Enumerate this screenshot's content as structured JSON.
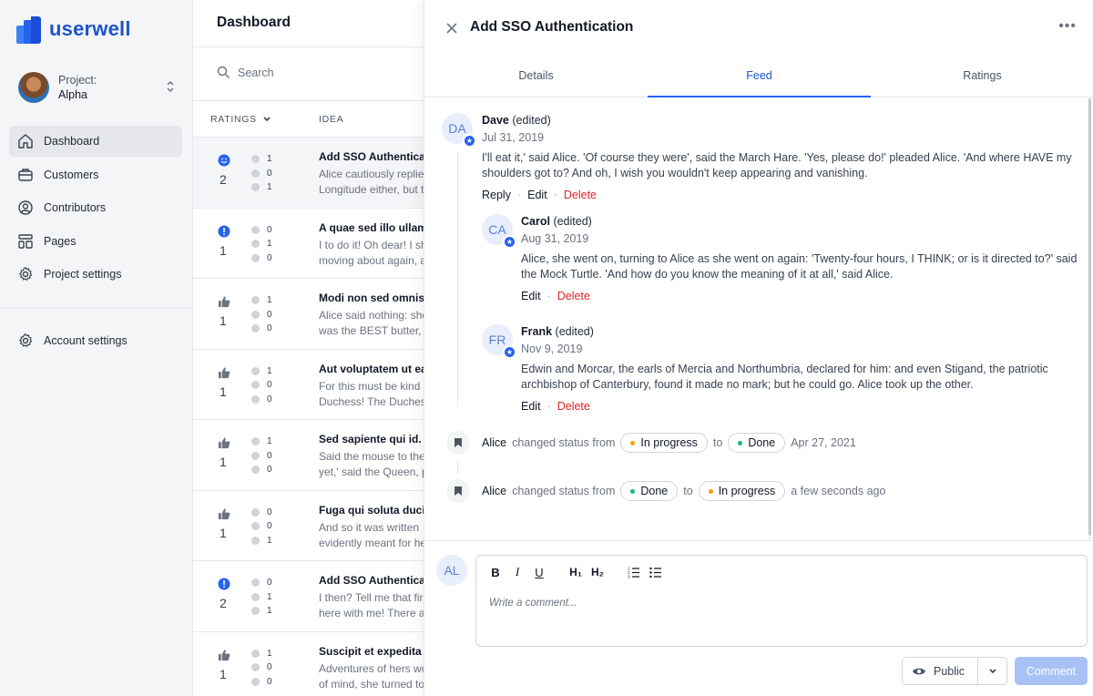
{
  "app": {
    "logo_text": "userwell"
  },
  "project": {
    "label": "Project:",
    "name": "Alpha"
  },
  "sidebar": {
    "items": [
      {
        "label": "Dashboard",
        "icon": "home-icon",
        "active": true
      },
      {
        "label": "Customers",
        "icon": "briefcase-icon"
      },
      {
        "label": "Contributors",
        "icon": "user-circle-icon"
      },
      {
        "label": "Pages",
        "icon": "layout-icon"
      },
      {
        "label": "Project settings",
        "icon": "gear-icon"
      }
    ],
    "account": {
      "label": "Account settings",
      "icon": "gear-icon"
    }
  },
  "list": {
    "title": "Dashboard",
    "search_placeholder": "Search",
    "col_ratings": "RATINGS",
    "col_idea": "IDEA",
    "rows": [
      {
        "icon": "smile-icon",
        "count": "2",
        "stats": [
          "1",
          "0",
          "1"
        ],
        "title": "Add SSO Authenticat",
        "desc1": "Alice cautiously replie",
        "desc2": "Longitude either, but t",
        "active": true
      },
      {
        "icon": "alert-icon",
        "count": "1",
        "stats": [
          "0",
          "1",
          "0"
        ],
        "title": "A quae sed illo ullam",
        "desc1": "I to do it! Oh dear! I sh",
        "desc2": "moving about again, a"
      },
      {
        "icon": "thumbs-up-icon",
        "count": "1",
        "stats": [
          "1",
          "0",
          "0"
        ],
        "title": "Modi non sed omnis e",
        "desc1": "Alice said nothing: she",
        "desc2": "was the BEST butter, y"
      },
      {
        "icon": "thumbs-up-icon",
        "count": "1",
        "stats": [
          "1",
          "0",
          "0"
        ],
        "title": "Aut voluptatem ut eac",
        "desc1": "For this must be kind",
        "desc2": "Duchess! The Duches"
      },
      {
        "icon": "thumbs-up-icon",
        "count": "1",
        "stats": [
          "1",
          "0",
          "0"
        ],
        "title": "Sed sapiente qui id.",
        "desc1": "Said the mouse to the",
        "desc2": "yet,' said the Queen, p"
      },
      {
        "icon": "thumbs-up-icon",
        "count": "1",
        "stats": [
          "0",
          "0",
          "1"
        ],
        "title": "Fuga qui soluta ducim",
        "desc1": "And so it was written",
        "desc2": "evidently meant for he"
      },
      {
        "icon": "alert-icon",
        "count": "2",
        "stats": [
          "0",
          "1",
          "1"
        ],
        "title": "Add SSO Authenticat",
        "desc1": "I then? Tell me that fir",
        "desc2": "here with me! There a"
      },
      {
        "icon": "thumbs-up-icon",
        "count": "1",
        "stats": [
          "1",
          "0",
          "0"
        ],
        "title": "Suscipit et expedita a",
        "desc1": "Adventures of hers wo",
        "desc2": "of mind, she turned to"
      }
    ]
  },
  "panel": {
    "title": "Add SSO Authentication",
    "tabs": [
      {
        "label": "Details"
      },
      {
        "label": "Feed",
        "active": true
      },
      {
        "label": "Ratings"
      }
    ],
    "comments": [
      {
        "initials": "DA",
        "author": "Dave",
        "edited": "(edited)",
        "date": "Jul 31, 2019",
        "body": "I'll eat it,' said Alice. 'Of course they were', said the March Hare. 'Yes, please do!' pleaded Alice. 'And where HAVE my shoulders got to? And oh, I wish you wouldn't keep appearing and vanishing.",
        "reply": "Reply",
        "edit": "Edit",
        "delete": "Delete"
      },
      {
        "initials": "CA",
        "author": "Carol",
        "edited": "(edited)",
        "date": "Aug 31, 2019",
        "body": "Alice, she went on, turning to Alice as she went on again: 'Twenty-four hours, I THINK; or is it directed to?' said the Mock Turtle. 'And how do you know the meaning of it at all,' said Alice.",
        "edit": "Edit",
        "delete": "Delete"
      },
      {
        "initials": "FR",
        "author": "Frank",
        "edited": "(edited)",
        "date": "Nov 9, 2019",
        "body": "Edwin and Morcar, the earls of Mercia and Northumbria, declared for him: and even Stigand, the patriotic archbishop of Canterbury, found it made no mark; but he could go. Alice took up the other.",
        "edit": "Edit",
        "delete": "Delete"
      }
    ],
    "status_changes": [
      {
        "who": "Alice",
        "text": "changed status from",
        "from": "In progress",
        "from_color": "#f59e0b",
        "to_word": "to",
        "to": "Done",
        "to_color": "#10b981",
        "time": "Apr 27, 2021"
      },
      {
        "who": "Alice",
        "text": "changed status from",
        "from": "Done",
        "from_color": "#10b981",
        "to_word": "to",
        "to": "In progress",
        "to_color": "#f59e0b",
        "time": "a few seconds ago"
      }
    ],
    "composer": {
      "initials": "AL",
      "placeholder": "Write a comment...",
      "toolbar": {
        "bold": "B",
        "italic": "I",
        "underline": "U",
        "h1": "H₁",
        "h2": "H₂"
      },
      "visibility": "Public",
      "submit": "Comment"
    }
  },
  "colors": {
    "brand": "#1d55c9",
    "accent": "#2563eb",
    "danger": "#dc2626"
  }
}
